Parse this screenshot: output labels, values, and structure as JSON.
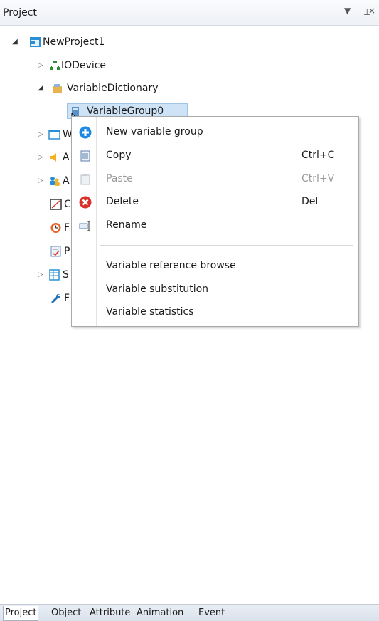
{
  "panel": {
    "title": "Project",
    "pin_glyph": "▾ ⊥ ×"
  },
  "tree": {
    "root": "NewProject1",
    "iodevice": "IODevice",
    "variable_dictionary": "VariableDictionary",
    "variable_group": "VariableGroup0",
    "partial_items": [
      "W",
      "A",
      "A",
      "C",
      "F",
      "P",
      "S",
      "F"
    ]
  },
  "context_menu": {
    "items": [
      {
        "label": "New variable group",
        "shortcut": "",
        "icon": "add-icon",
        "enabled": true
      },
      {
        "label": "Copy",
        "shortcut": "Ctrl+C",
        "icon": "copy-icon",
        "enabled": true
      },
      {
        "label": "Paste",
        "shortcut": "Ctrl+V",
        "icon": "paste-icon",
        "enabled": false
      },
      {
        "label": "Delete",
        "shortcut": "Del",
        "icon": "delete-icon",
        "enabled": true
      },
      {
        "label": "Rename",
        "shortcut": "",
        "icon": "rename-icon",
        "enabled": true
      },
      {
        "label": "Variable reference browse",
        "shortcut": "",
        "icon": "",
        "enabled": true
      },
      {
        "label": "Variable substitution",
        "shortcut": "",
        "icon": "",
        "enabled": true
      },
      {
        "label": "Variable statistics",
        "shortcut": "",
        "icon": "",
        "enabled": true
      }
    ]
  },
  "tabs": [
    "Project",
    "Object",
    "Attribute",
    "Animation",
    "Event"
  ],
  "colors": {
    "selection": "#cfe3f7",
    "delete_red": "#d9302a",
    "add_blue": "#1e88e5"
  }
}
